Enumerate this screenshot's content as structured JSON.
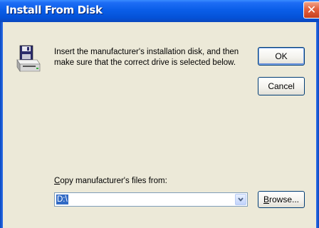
{
  "window": {
    "title": "Install From Disk"
  },
  "message": "Insert the manufacturer's installation disk, and then make sure that the correct drive is selected below.",
  "buttons": {
    "ok": "OK",
    "cancel": "Cancel",
    "browse_mnemonic": "B",
    "browse_rest": "rowse..."
  },
  "copy_from": {
    "label_mnemonic": "C",
    "label_rest": "opy manufacturer's files from:",
    "value": "D:\\"
  },
  "icons": {
    "close": "close-icon",
    "disk": "disk-drive-icon",
    "dropdown": "chevron-down-icon"
  },
  "colors": {
    "titlebar": "#0452D8",
    "dialog_bg": "#ECE9D8",
    "selection": "#316AC5",
    "close": "#E2603D"
  }
}
